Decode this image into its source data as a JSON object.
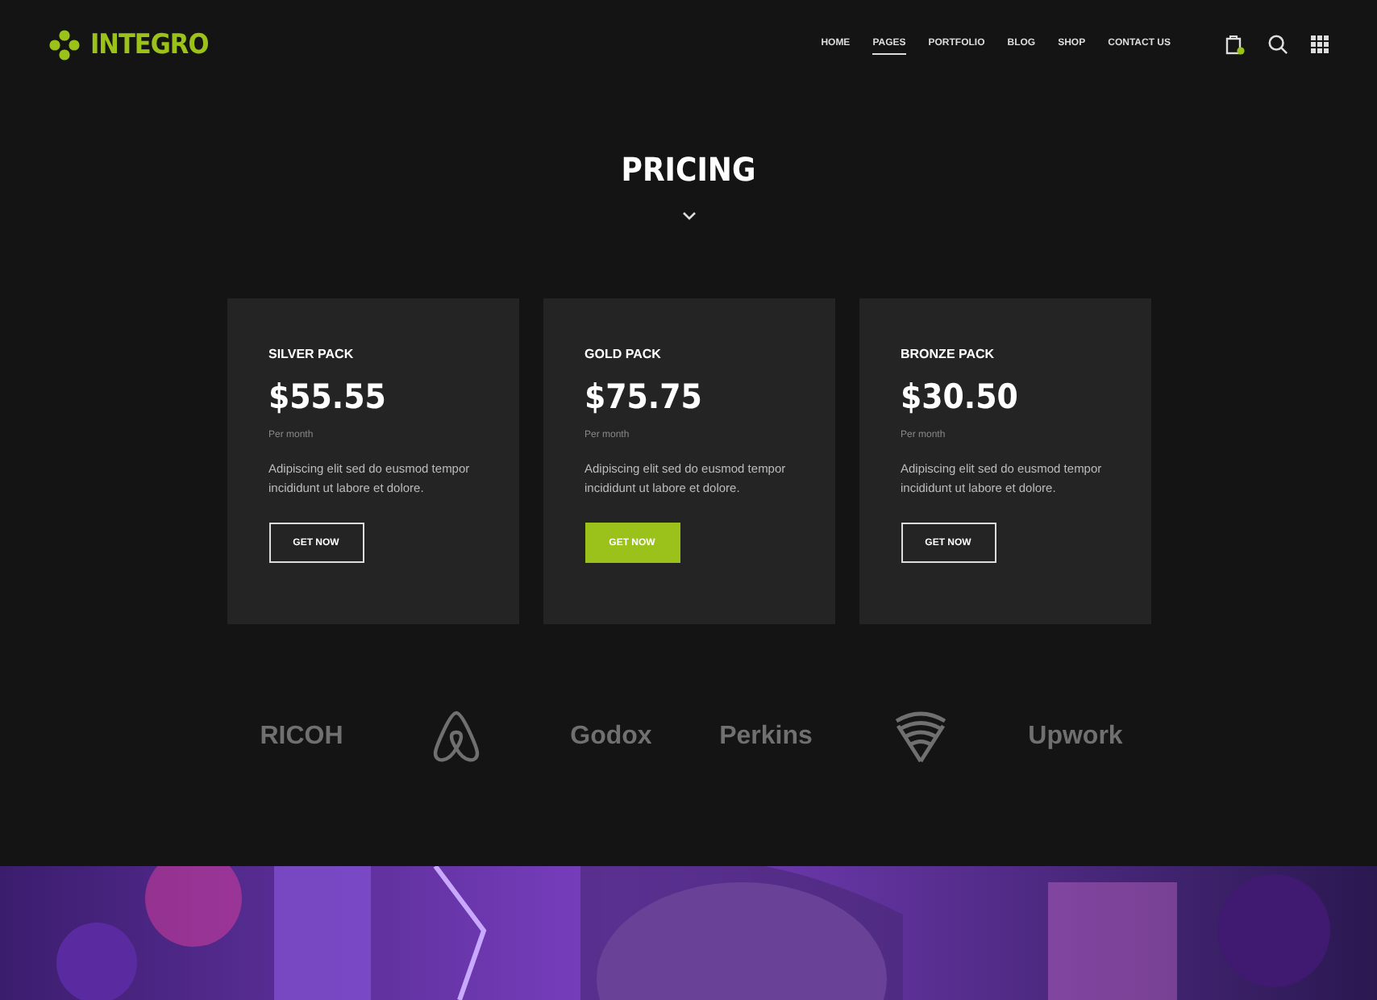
{
  "brand": {
    "name": "INTEGRO"
  },
  "nav": [
    {
      "label": "HOME",
      "selected": false
    },
    {
      "label": "PAGES",
      "selected": true
    },
    {
      "label": "PORTFOLIO",
      "selected": false
    },
    {
      "label": "BLOG",
      "selected": false
    },
    {
      "label": "SHOP",
      "selected": false
    },
    {
      "label": "CONTACT US",
      "selected": false
    }
  ],
  "heading": "PRICING",
  "plans": [
    {
      "name": "SILVER PACK",
      "price": "$55.55",
      "period": "Per month",
      "description": "Adipiscing elit sed do eusmod tempor incididunt ut labore et dolore.",
      "button": "GET NOW",
      "featured": false
    },
    {
      "name": "GOLD PACK",
      "price": "$75.75",
      "period": "Per month",
      "description": "Adipiscing elit sed do eusmod tempor incididunt ut labore et dolore.",
      "button": "GET NOW",
      "featured": true
    },
    {
      "name": "BRONZE PACK",
      "price": "$30.50",
      "period": "Per month",
      "description": "Adipiscing elit sed do eusmod tempor incididunt ut labore et dolore.",
      "button": "GET NOW",
      "featured": false
    }
  ],
  "logos": [
    {
      "kind": "wordmark",
      "text": "RICOH"
    },
    {
      "kind": "loop"
    },
    {
      "kind": "wordmark",
      "text": "Godox"
    },
    {
      "kind": "wordmark",
      "text": "Perkins"
    },
    {
      "kind": "waves"
    },
    {
      "kind": "wordmark",
      "text": "Upwork"
    }
  ]
}
